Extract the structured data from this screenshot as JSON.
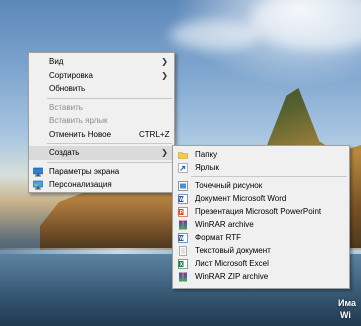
{
  "desktop": {
    "watermark_line1": "Има",
    "watermark_line2": "Wi"
  },
  "context_menu": {
    "items": [
      {
        "label": "Вид"
      },
      {
        "label": "Сортировка"
      },
      {
        "label": "Обновить"
      },
      {
        "label": "Вставить"
      },
      {
        "label": "Вставить ярлык"
      },
      {
        "label": "Отменить Новое",
        "shortcut": "CTRL+Z"
      },
      {
        "label": "Создать"
      },
      {
        "label": "Параметры экрана"
      },
      {
        "label": "Персонализация"
      }
    ]
  },
  "create_submenu": {
    "items": [
      {
        "label": "Папку",
        "icon": "folder-icon"
      },
      {
        "label": "Ярлык",
        "icon": "shortcut-icon"
      },
      {
        "label": "Точечный рисунок",
        "icon": "bitmap-icon"
      },
      {
        "label": "Документ Microsoft Word",
        "icon": "word-icon"
      },
      {
        "label": "Презентация Microsoft PowerPoint",
        "icon": "powerpoint-icon"
      },
      {
        "label": "WinRAR archive",
        "icon": "winrar-icon"
      },
      {
        "label": "Формат RTF",
        "icon": "rtf-icon"
      },
      {
        "label": "Текстовый документ",
        "icon": "text-document-icon"
      },
      {
        "label": "Лист Microsoft Excel",
        "icon": "excel-icon"
      },
      {
        "label": "WinRAR ZIP archive",
        "icon": "winrar-zip-icon"
      }
    ]
  },
  "colors": {
    "menu_bg": "#f0f0f0",
    "hover_bg": "#dadada",
    "disabled_text": "#8c8c8c"
  }
}
